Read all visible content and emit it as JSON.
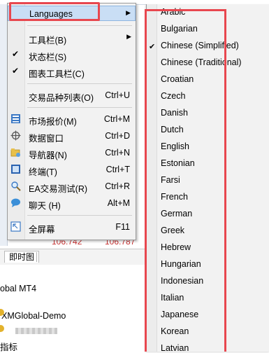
{
  "menu": {
    "items": [
      {
        "label": "Languages",
        "has_submenu": true,
        "highlighted": true
      },
      {
        "label": "工具栏(B)",
        "has_submenu": true
      },
      {
        "label": "状态栏(S)",
        "checked": true
      },
      {
        "label": "图表工具栏(C)",
        "checked": true
      },
      {
        "label": "交易品种列表(O)",
        "shortcut": "Ctrl+U"
      },
      {
        "label": "市场报价(M)",
        "shortcut": "Ctrl+M",
        "icon": "market-watch-icon"
      },
      {
        "label": "数据窗口",
        "shortcut": "Ctrl+D",
        "icon": "crosshair-icon"
      },
      {
        "label": "导航器(N)",
        "shortcut": "Ctrl+N",
        "icon": "navigator-folder-icon"
      },
      {
        "label": "终端(T)",
        "shortcut": "Ctrl+T",
        "icon": "terminal-icon"
      },
      {
        "label": "EA交易测试(R)",
        "shortcut": "Ctrl+R",
        "icon": "magnifier-icon"
      },
      {
        "label": "聊天 (H)",
        "shortcut": "Alt+M",
        "icon": "chat-icon"
      },
      {
        "label": "全屏幕",
        "shortcut": "F11",
        "icon": "fullscreen-icon"
      }
    ]
  },
  "languages": [
    "Arabic",
    "Bulgarian",
    "Chinese (Simplified)",
    "Chinese (Traditional)",
    "Croatian",
    "Czech",
    "Danish",
    "Dutch",
    "English",
    "Estonian",
    "Farsi",
    "French",
    "German",
    "Greek",
    "Hebrew",
    "Hungarian",
    "Indonesian",
    "Italian",
    "Japanese",
    "Korean",
    "Latvian"
  ],
  "checked_language": "Chinese (Simplified)",
  "background": {
    "prices": [
      "106.742",
      "106.787"
    ],
    "tab_label": "即时图",
    "navigator": [
      "obal MT4",
      "XMGlobal-Demo",
      "指标"
    ]
  },
  "colors": {
    "highlight_outline": "#e8474f",
    "price_text": "#c83232",
    "selection": "#c9def5"
  }
}
